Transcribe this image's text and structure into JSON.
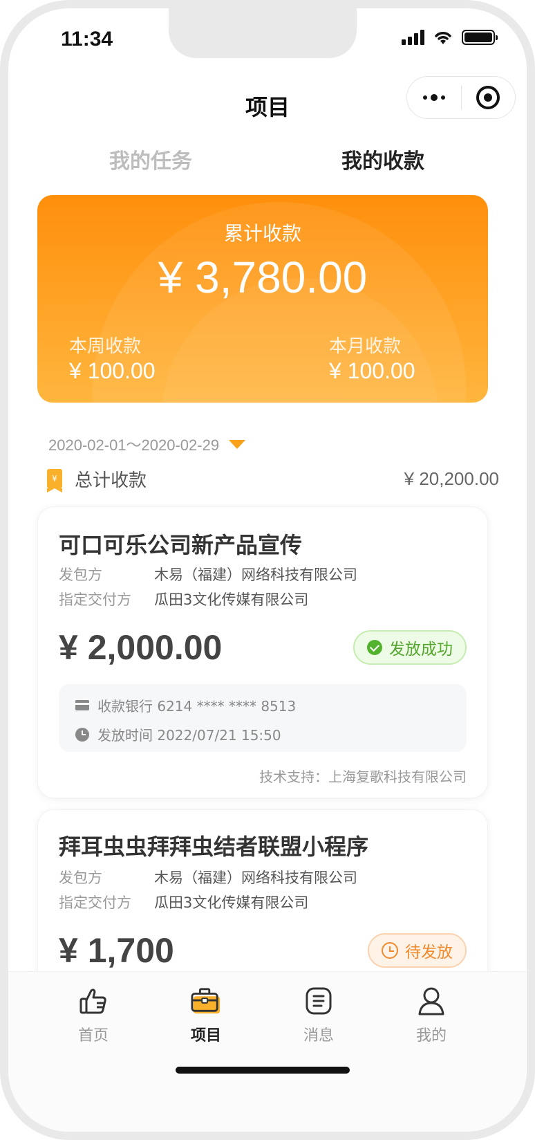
{
  "status_bar": {
    "time": "11:34"
  },
  "nav": {
    "title": "项目"
  },
  "tabs": [
    {
      "label": "我的任务",
      "active": false
    },
    {
      "label": "我的收款",
      "active": true
    }
  ],
  "summary": {
    "total_label": "累计收款",
    "total_amount": "¥ 3,780.00",
    "week_label": "本周收款",
    "week_amount": "¥ 100.00",
    "month_label": "本月收款",
    "month_amount": "¥ 100.00"
  },
  "filter": {
    "date_range": "2020-02-01～2020-02-29"
  },
  "total_row": {
    "icon_text": "¥",
    "label": "总计收款",
    "value": "¥ 20,200.00"
  },
  "cards": [
    {
      "title": "可口可乐公司新产品宣传",
      "issuer_label": "发包方",
      "issuer": "木易（福建）网络科技有限公司",
      "payer_label": "指定交付方",
      "payer": "瓜田3文化传媒有限公司",
      "amount": "¥ 2,000.00",
      "status": "发放成功",
      "bank": "收款银行 6214 **** **** 8513",
      "time": "发放时间 2022/07/21 15:50",
      "support": "技术支持：上海复歌科技有限公司"
    },
    {
      "title": "拜耳虫虫拜拜虫结者联盟小程序",
      "issuer_label": "发包方",
      "issuer": "木易（福建）网络科技有限公司",
      "payer_label": "指定交付方",
      "payer": "瓜田3文化传媒有限公司",
      "amount": "¥ 1,700",
      "status": "待发放"
    }
  ],
  "tabbar": [
    {
      "label": "首页",
      "icon": "thumbs-up-icon",
      "active": false
    },
    {
      "label": "项目",
      "icon": "briefcase-icon",
      "active": true
    },
    {
      "label": "消息",
      "icon": "message-icon",
      "active": false
    },
    {
      "label": "我的",
      "icon": "user-icon",
      "active": false
    }
  ],
  "colors": {
    "accent": "#f9a21b",
    "hero_top": "#ff8f0c",
    "hero_bottom": "#ffb63e",
    "success": "#53a52b",
    "pending": "#f08a2c"
  }
}
